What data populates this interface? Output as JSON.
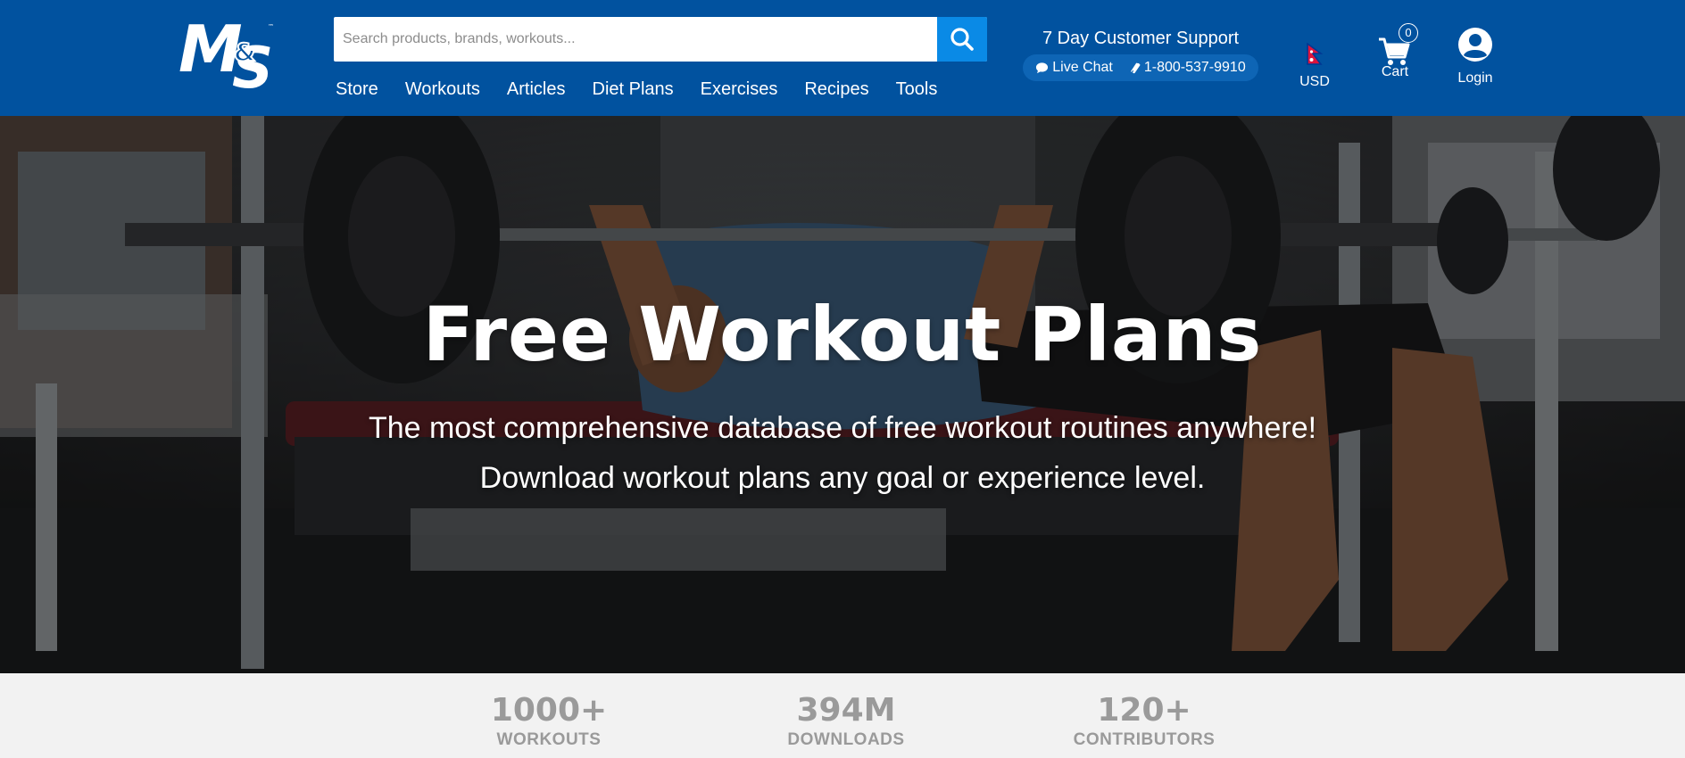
{
  "brand": {
    "logo_text": "M&S",
    "primary_color": "#01529f",
    "accent_color": "#0a8ae6"
  },
  "search": {
    "placeholder": "Search products, brands, workouts...",
    "icon": "search-icon"
  },
  "nav": {
    "items": [
      {
        "label": "Store"
      },
      {
        "label": "Workouts"
      },
      {
        "label": "Articles"
      },
      {
        "label": "Diet Plans"
      },
      {
        "label": "Exercises"
      },
      {
        "label": "Recipes"
      },
      {
        "label": "Tools"
      }
    ]
  },
  "support": {
    "title": "7 Day Customer Support",
    "live_chat_label": "Live Chat",
    "live_chat_icon": "chat-bubble-icon",
    "phone": "1-800-537-9910",
    "phone_icon": "phone-icon"
  },
  "utility": {
    "currency_label": "USD",
    "currency_icon": "nepal-flag-icon",
    "cart_label": "Cart",
    "cart_count": "0",
    "cart_icon": "cart-icon",
    "login_label": "Login",
    "login_icon": "user-avatar-icon"
  },
  "hero": {
    "title": "Free Workout Plans",
    "subtitle_line1": "The most comprehensive database of free workout routines anywhere!",
    "subtitle_line2": "Download workout plans any goal or experience level."
  },
  "stats": [
    {
      "value": "1000+",
      "label": "WORKOUTS"
    },
    {
      "value": "394M",
      "label": "DOWNLOADS"
    },
    {
      "value": "120+",
      "label": "CONTRIBUTORS"
    }
  ]
}
